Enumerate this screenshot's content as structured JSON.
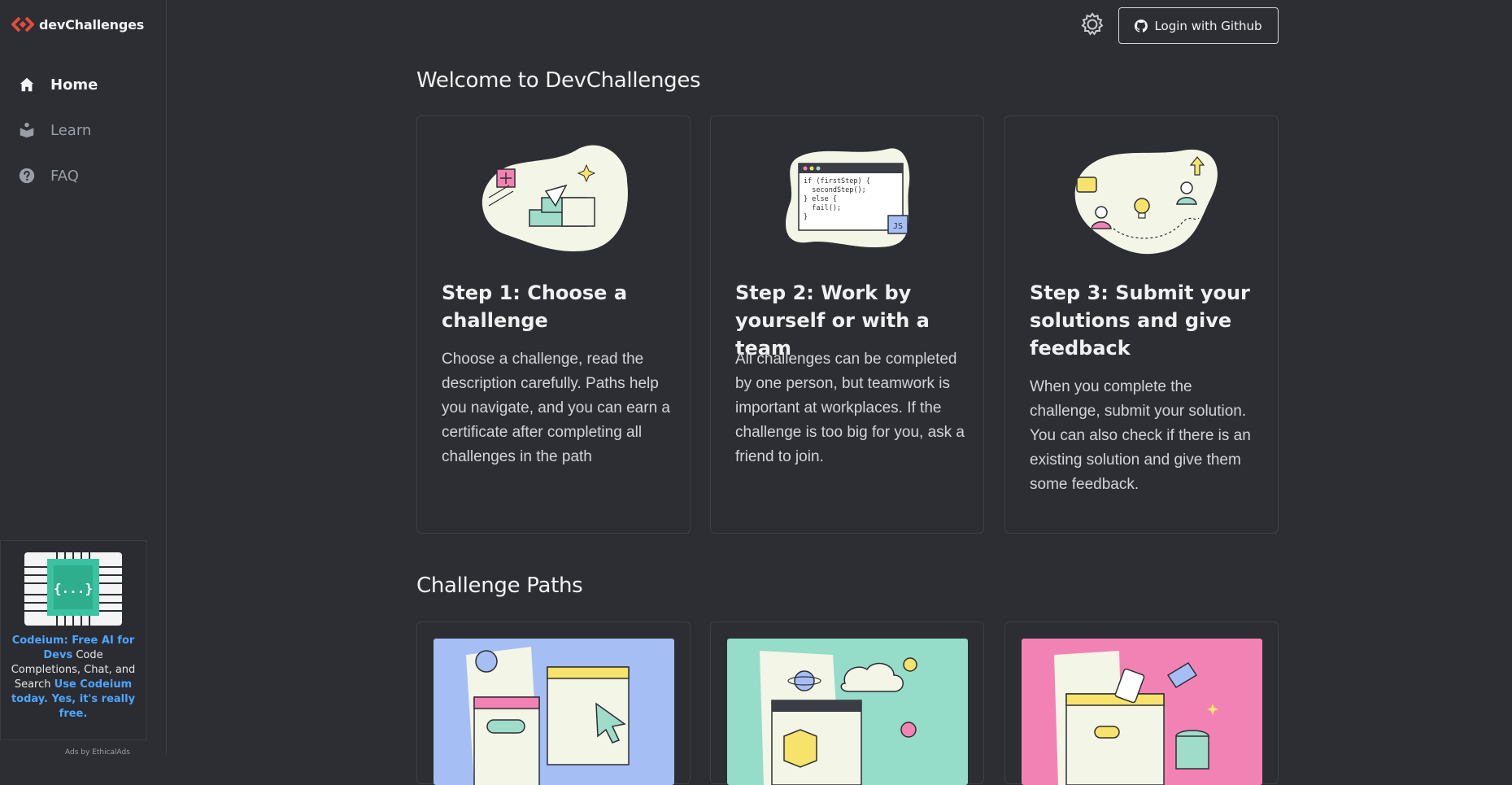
{
  "app": {
    "logo_text": "devChallenges"
  },
  "sidebar": {
    "items": [
      {
        "label": "Home",
        "icon": "home-icon",
        "active": true
      },
      {
        "label": "Learn",
        "icon": "learn-icon",
        "active": false
      },
      {
        "label": "FAQ",
        "icon": "question-icon",
        "active": false
      }
    ]
  },
  "ad": {
    "link_text": "Codeium: Free AI for Devs",
    "body_text": " Code Completions, Chat, and Search ",
    "cta_text": "Use Codeium today. Yes, it's really free.",
    "footer": "Ads by EthicalAds",
    "image_badge": "{...}"
  },
  "header": {
    "theme_icon": "gear-icon",
    "login_label": "Login with Github"
  },
  "welcome": {
    "title": "Welcome to DevChallenges",
    "steps": [
      {
        "title": "Step 1: Choose a challenge",
        "description": "Choose a challenge, read the description carefully. Paths help you navigate, and you can earn a certificate after completing all challenges in the path"
      },
      {
        "title": "Step 2: Work by yourself or with a team",
        "description": "All challenges can be completed by one person, but teamwork is important at workplaces. If the challenge is too big for you, ask a friend to join.",
        "code_lines": [
          "if (firstStep) {",
          "  secondStep();",
          "} else {",
          "  fail();",
          "}"
        ],
        "code_badge": "JS"
      },
      {
        "title": "Step 3: Submit your solutions and give feedback",
        "description": "When you complete the challenge, submit your solution. You can also check if there is an existing solution and give them some feedback."
      }
    ]
  },
  "paths": {
    "title": "Challenge Paths",
    "cards": [
      {
        "color": "#a5bff5"
      },
      {
        "color": "#95dcc9"
      },
      {
        "color": "#f382b4"
      }
    ]
  },
  "colors": {
    "background": "#2c2e33",
    "accent_red": "#e34b3f",
    "link_blue": "#4ea5ff",
    "illustration_cream": "#f3f5e7",
    "teal": "#9fdcca"
  }
}
